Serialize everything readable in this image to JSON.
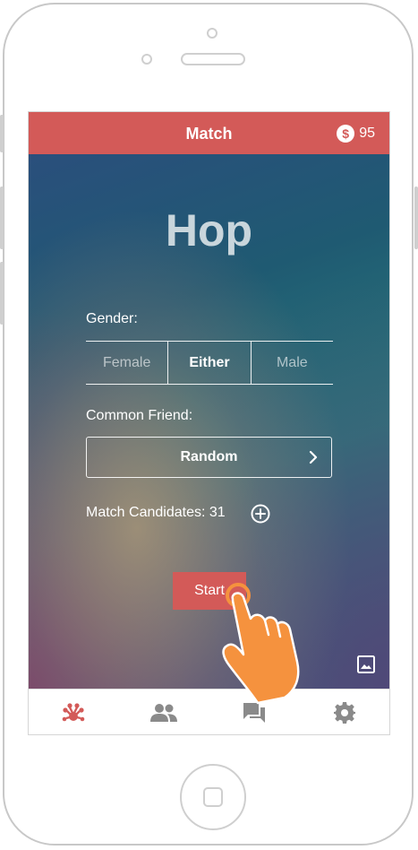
{
  "header": {
    "title": "Match",
    "coins": "95",
    "coin_icon": "dollar-coin-icon"
  },
  "app": {
    "logo_text": "Hop"
  },
  "gender": {
    "label": "Gender:",
    "options": [
      "Female",
      "Either",
      "Male"
    ],
    "selected": "Either"
  },
  "common_friend": {
    "label": "Common Friend:",
    "value": "Random"
  },
  "candidates": {
    "text": "Match Candidates: 31"
  },
  "start": {
    "label": "Start"
  },
  "tabs": [
    "match-icon",
    "friends-icon",
    "chat-icon",
    "settings-icon"
  ],
  "colors": {
    "accent": "#d35a58",
    "hand": "#f5923e"
  }
}
